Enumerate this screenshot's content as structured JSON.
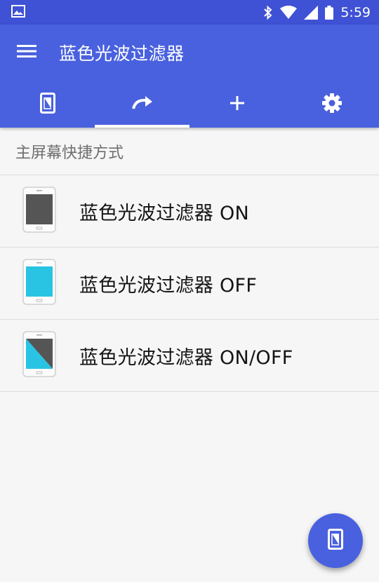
{
  "status_bar": {
    "time": "5:59",
    "icons": [
      "image-icon",
      "bluetooth-icon",
      "wifi-icon",
      "signal-icon",
      "battery-icon"
    ]
  },
  "app_bar": {
    "title": "蓝色光波过滤器",
    "tabs": [
      {
        "name": "tab-filter",
        "icon": "phone-filter-icon",
        "active": false
      },
      {
        "name": "tab-shortcut",
        "icon": "redo-arrow-icon",
        "active": true
      },
      {
        "name": "tab-add",
        "icon": "plus-icon",
        "active": false
      },
      {
        "name": "tab-settings",
        "icon": "gear-icon",
        "active": false
      }
    ]
  },
  "section": {
    "header": "主屏幕快捷方式"
  },
  "shortcuts": [
    {
      "label": "蓝色光波过滤器 ON",
      "icon": "phone-on-icon"
    },
    {
      "label": "蓝色光波过滤器 OFF",
      "icon": "phone-off-icon"
    },
    {
      "label": "蓝色光波过滤器 ON/OFF",
      "icon": "phone-toggle-icon"
    }
  ],
  "fab": {
    "icon": "phone-filter-icon"
  },
  "colors": {
    "primary": "#4961de",
    "status_bar": "#3f51d4",
    "screen_on": "#555555",
    "screen_off": "#29c4e3"
  }
}
